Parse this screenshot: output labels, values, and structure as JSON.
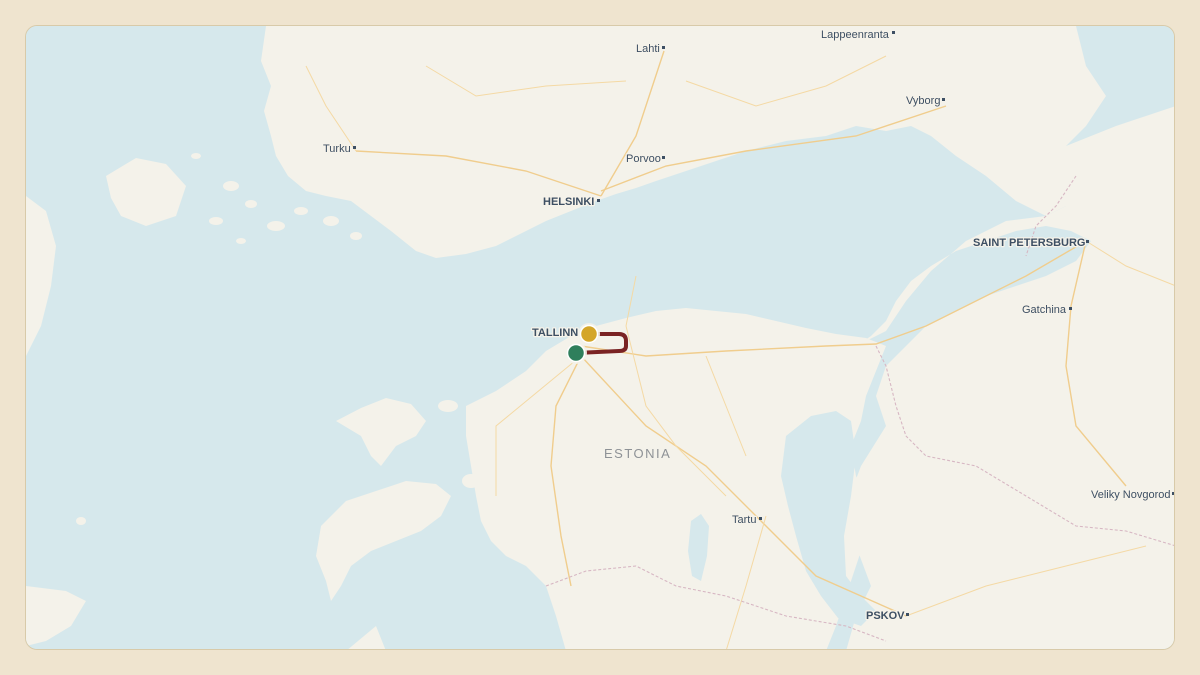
{
  "map": {
    "colors": {
      "water": "#d6e8ec",
      "land": "#f4f2ea",
      "route": "#7a2323",
      "marker_start": "#2f7f5c",
      "marker_end": "#d4a62a",
      "frame": "#efe4cf"
    },
    "country_label": "ESTONIA",
    "cities": [
      {
        "id": "lappeenranta",
        "label": "Lappeenranta",
        "capital": false
      },
      {
        "id": "lahti",
        "label": "Lahti",
        "capital": false
      },
      {
        "id": "vyborg",
        "label": "Vyborg",
        "capital": false
      },
      {
        "id": "turku",
        "label": "Turku",
        "capital": false
      },
      {
        "id": "porvoo",
        "label": "Porvoo",
        "capital": false
      },
      {
        "id": "helsinki",
        "label": "HELSINKI",
        "capital": true
      },
      {
        "id": "saint-petersburg",
        "label": "SAINT PETERSBURG",
        "capital": true
      },
      {
        "id": "gatchina",
        "label": "Gatchina",
        "capital": false
      },
      {
        "id": "tallinn",
        "label": "TALLINN",
        "capital": true
      },
      {
        "id": "tartu",
        "label": "Tartu",
        "capital": false
      },
      {
        "id": "veliky-novgorod",
        "label": "Veliky Novgorod",
        "capital": false
      },
      {
        "id": "pskov",
        "label": "PSKOV",
        "capital": true
      }
    ],
    "route": {
      "start_icon": "route-start-marker-icon",
      "end_icon": "route-end-marker-icon"
    }
  }
}
